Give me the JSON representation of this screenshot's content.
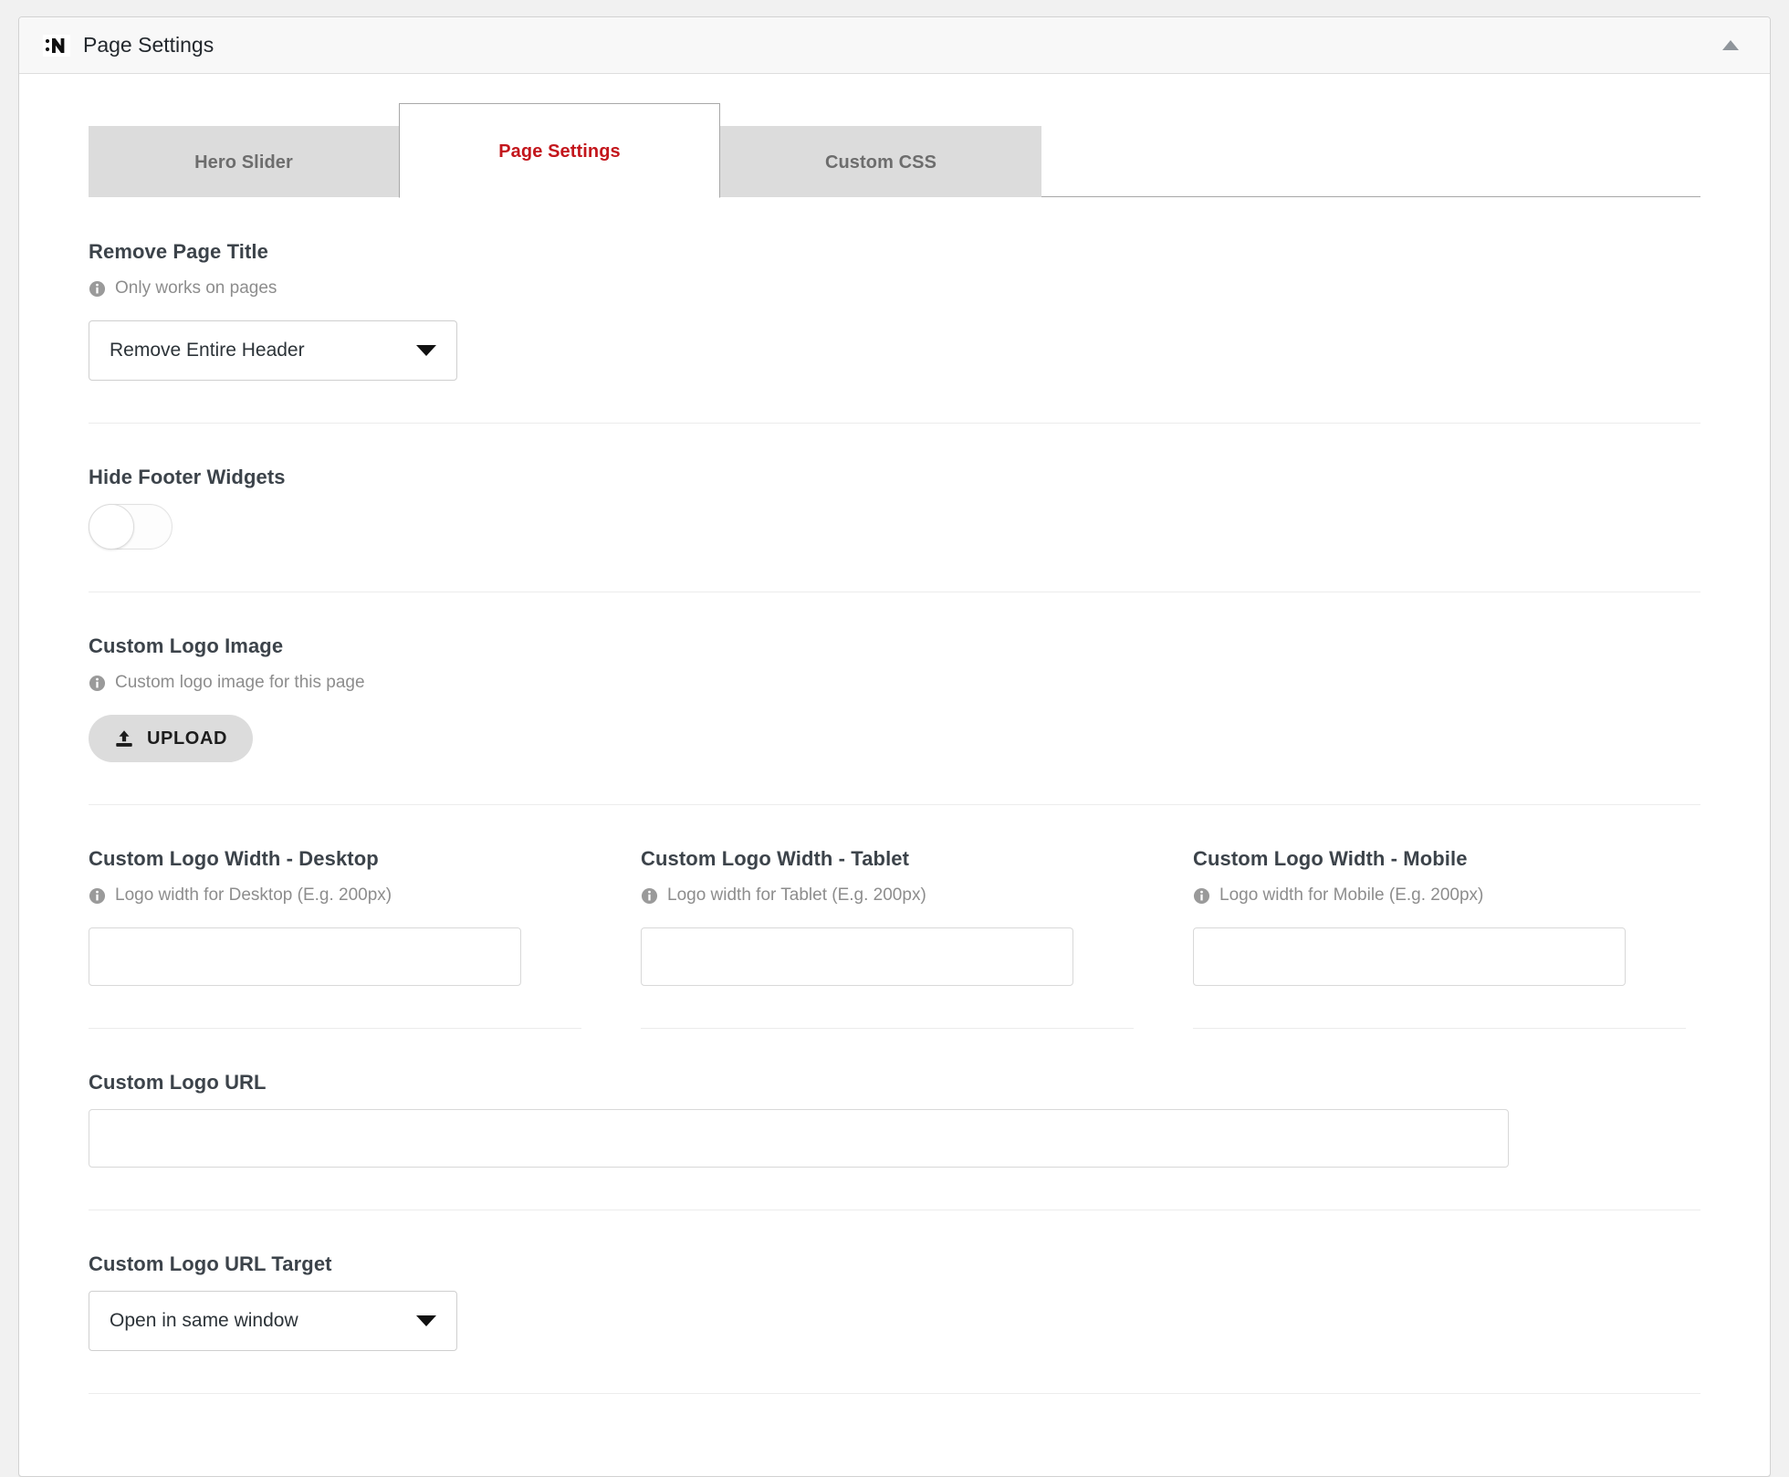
{
  "panel": {
    "title": "Page Settings",
    "brand_icon": "nectar-n-icon",
    "collapse_icon": "caret-up-icon"
  },
  "tabs": [
    {
      "label": "Hero Slider",
      "active": false
    },
    {
      "label": "Page Settings",
      "active": true
    },
    {
      "label": "Custom CSS",
      "active": false
    }
  ],
  "colors": {
    "active_tab_text": "#c3161c",
    "inactive_tab_bg": "#dcdcdc",
    "inactive_tab_text": "#6d6d6d",
    "panel_header_bg": "#f8f8f8",
    "page_bg": "#f1f1f1"
  },
  "fields": {
    "remove_page_title": {
      "title": "Remove Page Title",
      "desc": "Only works on pages",
      "desc_icon": "info-icon",
      "select_value": "Remove Entire Header",
      "caret_icon": "caret-down-icon"
    },
    "hide_footer_widgets": {
      "title": "Hide Footer Widgets",
      "toggle_state": "off"
    },
    "custom_logo_image": {
      "title": "Custom Logo Image",
      "desc": "Custom logo image for this page",
      "desc_icon": "info-icon",
      "upload_label": "UPLOAD",
      "upload_icon": "upload-icon"
    },
    "logo_width_desktop": {
      "title": "Custom Logo Width - Desktop",
      "desc": "Logo width for Desktop (E.g. 200px)",
      "desc_icon": "info-icon",
      "value": "",
      "placeholder": ""
    },
    "logo_width_tablet": {
      "title": "Custom Logo Width - Tablet",
      "desc": "Logo width for Tablet (E.g. 200px)",
      "desc_icon": "info-icon",
      "value": "",
      "placeholder": ""
    },
    "logo_width_mobile": {
      "title": "Custom Logo Width - Mobile",
      "desc": "Logo width for Mobile (E.g. 200px)",
      "desc_icon": "info-icon",
      "value": "",
      "placeholder": ""
    },
    "custom_logo_url": {
      "title": "Custom Logo URL",
      "value": "",
      "placeholder": ""
    },
    "custom_logo_url_target": {
      "title": "Custom Logo URL Target",
      "select_value": "Open in same window",
      "caret_icon": "caret-down-icon"
    }
  }
}
